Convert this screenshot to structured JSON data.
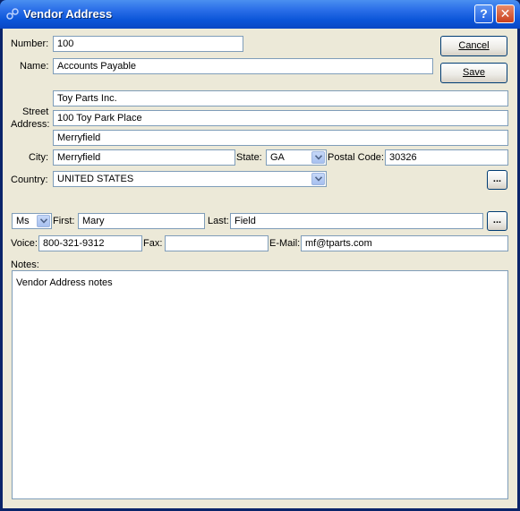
{
  "window": {
    "title": "Vendor Address"
  },
  "form": {
    "number_label": "Number:",
    "number": "100",
    "name_label": "Name:",
    "name": "Accounts Payable",
    "street_label_1": "Street",
    "street_label_2": "Address:",
    "street_line1": "Toy Parts Inc.",
    "street_line2": "100 Toy Park Place",
    "street_line3": "Merryfield",
    "city_label": "City:",
    "city": "Merryfield",
    "state_label": "State:",
    "state": "GA",
    "postal_label": "Postal Code:",
    "postal_code": "30326",
    "country_label": "Country:",
    "country": "UNITED STATES",
    "honorific": "Ms",
    "first_label": "First:",
    "first": "Mary",
    "last_label": "Last:",
    "last": "Field",
    "voice_label": "Voice:",
    "voice": "800-321-9312",
    "fax_label": "Fax:",
    "fax": "",
    "email_label": "E-Mail:",
    "email": "mf@tparts.com",
    "notes_label": "Notes:",
    "notes": "Vendor Address notes"
  },
  "buttons": {
    "cancel_label": "Cancel",
    "save_label": "Save",
    "ellipsis_label": "..."
  }
}
